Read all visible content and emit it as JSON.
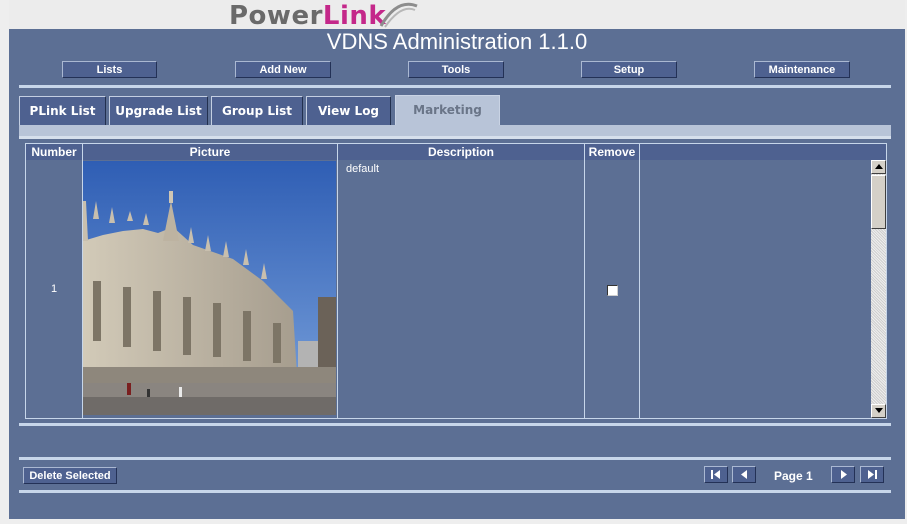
{
  "brand": {
    "logo_plain": "Power",
    "logo_accent": "Link"
  },
  "app_title": "VDNS Administration 1.1.0",
  "nav": {
    "lists": "Lists",
    "add_new": "Add New",
    "tools": "Tools",
    "setup": "Setup",
    "maintenance": "Maintenance"
  },
  "tabs": [
    "PLink List",
    "Upgrade List",
    "Group List",
    "View Log",
    "Marketing"
  ],
  "active_tab": "Marketing",
  "grid": {
    "columns": [
      "Number",
      "Picture",
      "Description",
      "Remove"
    ],
    "rows": [
      {
        "number": "1",
        "picture": "cathedral-photo",
        "description": "default",
        "remove": false
      }
    ]
  },
  "footer": {
    "delete_selected": "Delete Selected",
    "page_label": "Page 1"
  },
  "colors": {
    "panel": "#5c6f94",
    "button": "#4e6190",
    "rule": "#c7d6ea",
    "logo_accent": "#c4288a"
  }
}
